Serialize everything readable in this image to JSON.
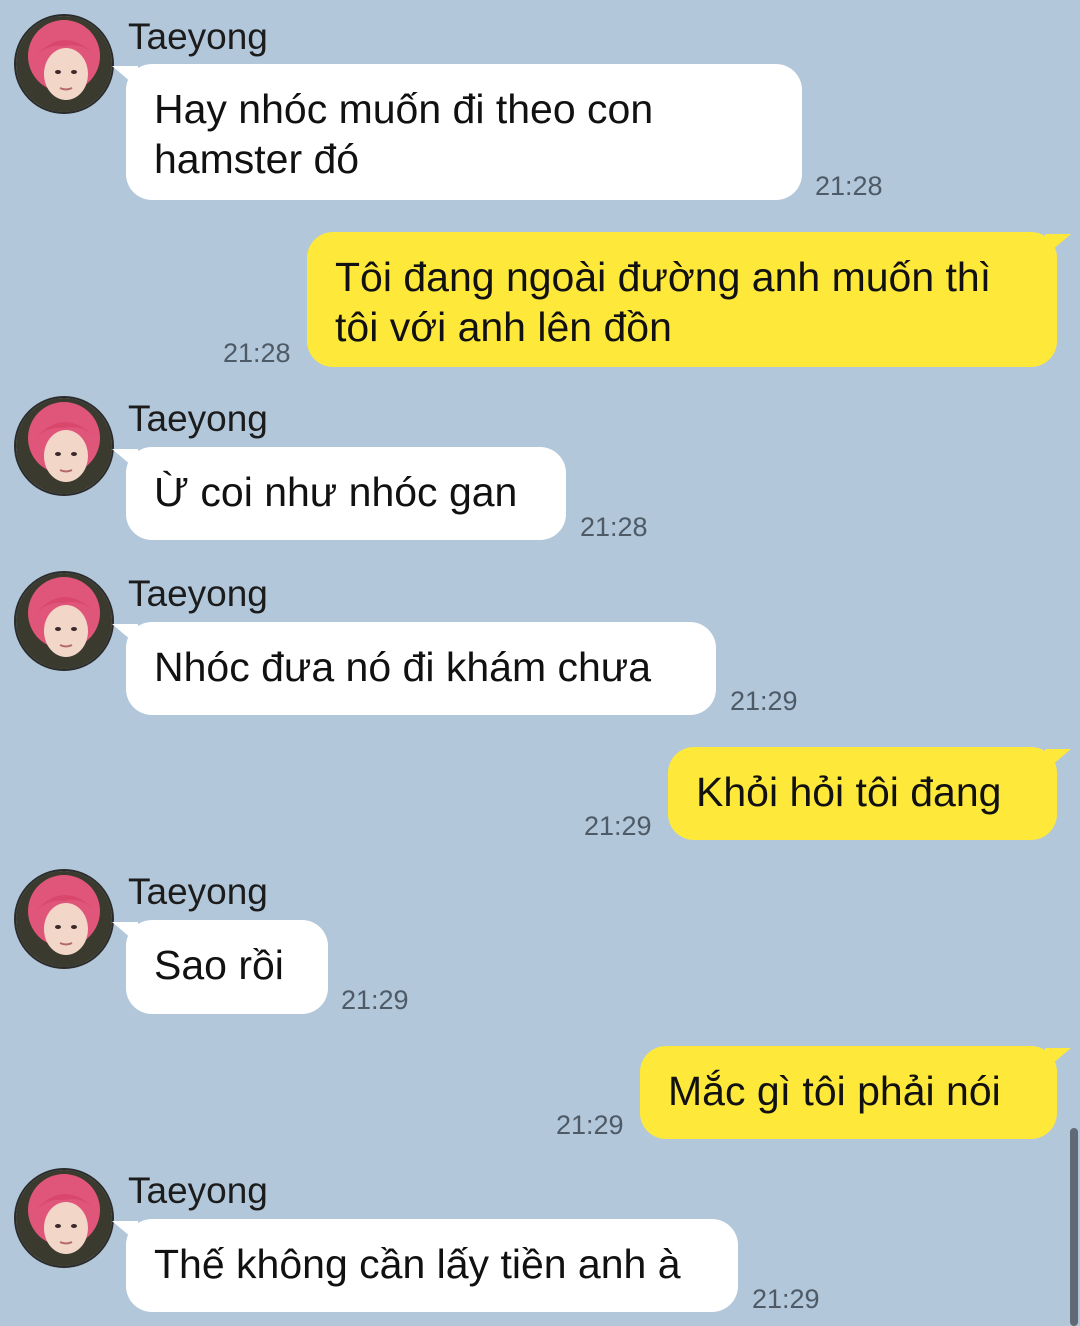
{
  "contact": {
    "name": "Taeyong",
    "avatar_icon": "profile-photo-pink-hair"
  },
  "colors": {
    "background": "#b2c7da",
    "incoming_bubble": "#ffffff",
    "outgoing_bubble": "#fee83a",
    "timestamp": "#4e5a66"
  },
  "messages": [
    {
      "direction": "in",
      "sender": "Taeyong",
      "text": "Hay nhóc muốn đi theo con\nhamster đó",
      "time": "21:28"
    },
    {
      "direction": "out",
      "text": "Tôi đang ngoài đường anh muốn thì\ntôi với anh lên đồn",
      "time": "21:28"
    },
    {
      "direction": "in",
      "sender": "Taeyong",
      "text": "Ừ coi như nhóc gan",
      "time": "21:28"
    },
    {
      "direction": "in",
      "sender": "Taeyong",
      "text": "Nhóc đưa nó đi khám chưa",
      "time": "21:29"
    },
    {
      "direction": "out",
      "text": "Khỏi hỏi tôi đang",
      "time": "21:29"
    },
    {
      "direction": "in",
      "sender": "Taeyong",
      "text": "Sao rồi",
      "time": "21:29"
    },
    {
      "direction": "out",
      "text": "Mắc gì tôi phải nói",
      "time": "21:29"
    },
    {
      "direction": "in",
      "sender": "Taeyong",
      "text": "Thế không cần lấy tiền anh à",
      "time": "21:29"
    }
  ]
}
